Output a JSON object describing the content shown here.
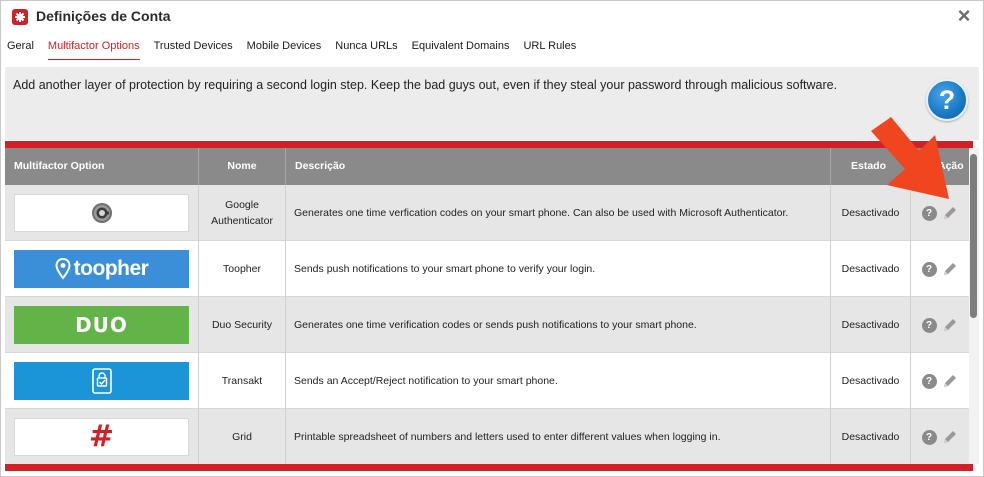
{
  "window": {
    "title": "Definições de Conta",
    "close_label": "×"
  },
  "tabs": [
    {
      "label": "Geral",
      "active": false
    },
    {
      "label": "Multifactor Options",
      "active": true
    },
    {
      "label": "Trusted Devices",
      "active": false
    },
    {
      "label": "Mobile Devices",
      "active": false
    },
    {
      "label": "Nunca URLs",
      "active": false
    },
    {
      "label": "Equivalent Domains",
      "active": false
    },
    {
      "label": "URL Rules",
      "active": false
    }
  ],
  "intro": {
    "text": "Add another layer of protection by requiring a second login step. Keep the bad guys out, even if they steal your password through malicious software.",
    "help_label": "?"
  },
  "table": {
    "headers": [
      "Multifactor Option",
      "Nome",
      "Descrição",
      "Estado",
      "Ação"
    ],
    "rows": [
      {
        "logo": "google-authenticator-logo",
        "logo_text": "",
        "name": "Google Authenticator",
        "description": "Generates one time verfication codes on your smart phone. Can also be used with Microsoft Authenticator.",
        "status": "Desactivado"
      },
      {
        "logo": "toopher-logo",
        "logo_text": "toopher",
        "name": "Toopher",
        "description": "Sends push notifications to your smart phone to verify your login.",
        "status": "Desactivado"
      },
      {
        "logo": "duo-logo",
        "logo_text": "DUO",
        "name": "Duo Security",
        "description": "Generates one time verification codes or sends push notifications to your smart phone.",
        "status": "Desactivado"
      },
      {
        "logo": "transakt-logo",
        "logo_text": "",
        "name": "Transakt",
        "description": "Sends an Accept/Reject notification to your smart phone.",
        "status": "Desactivado"
      },
      {
        "logo": "grid-logo",
        "logo_text": "#",
        "name": "Grid",
        "description": "Printable spreadsheet of numbers and letters used to enter different values when logging in.",
        "status": "Desactivado"
      }
    ],
    "row_help_label": "?"
  },
  "colors": {
    "accent": "#d32027",
    "header_bg": "#8a8a8a",
    "toopher_blue": "#3a8fd8",
    "duo_green": "#62b348",
    "transakt_blue": "#1c95d8",
    "arrow": "#f0451e"
  }
}
